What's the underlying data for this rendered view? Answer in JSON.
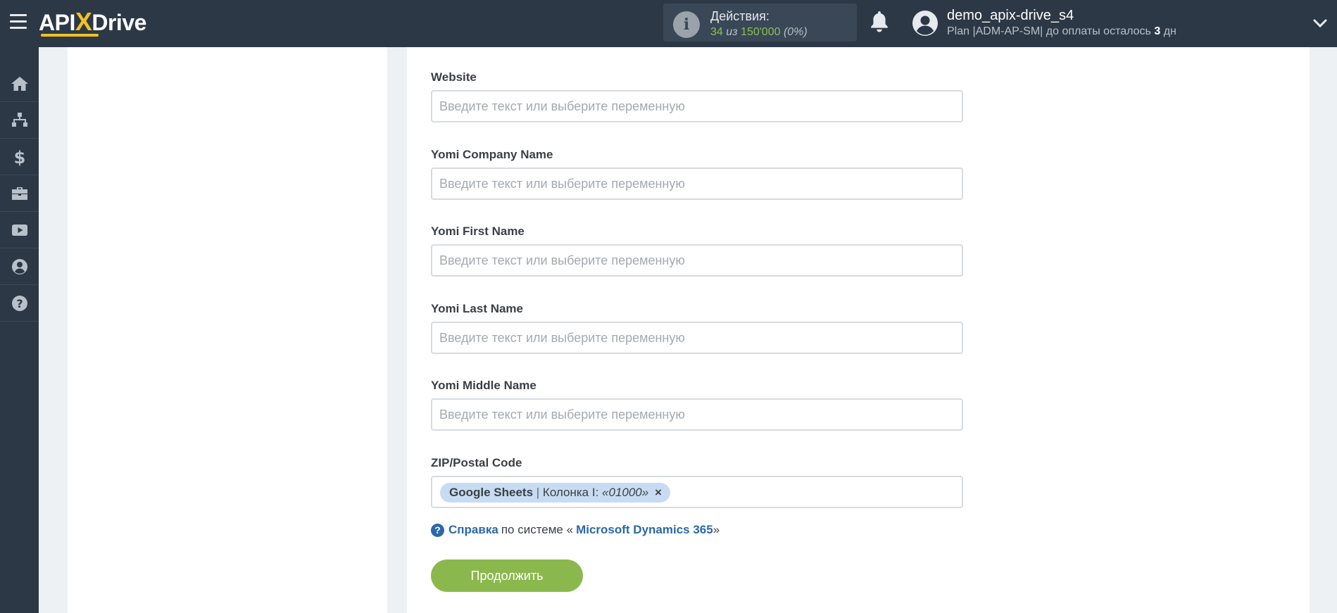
{
  "header": {
    "logo_prefix": "API",
    "logo_x": "X",
    "logo_suffix": "Drive",
    "actions_label": "Действия:",
    "actions_used": "34",
    "actions_of": "из",
    "actions_total": "150'000",
    "actions_percent": "(0%)",
    "user_name": "demo_apix-drive_s4",
    "plan_text": "Plan |ADM-AP-SM| до оплаты осталось",
    "plan_days": "3",
    "plan_days_unit": "дн",
    "accent_color": "#f4c022"
  },
  "sidebar": {
    "items": [
      {
        "icon": "home-icon"
      },
      {
        "icon": "sitemap-icon"
      },
      {
        "icon": "dollar-icon"
      },
      {
        "icon": "briefcase-icon"
      },
      {
        "icon": "youtube-icon"
      },
      {
        "icon": "user-circle-icon"
      },
      {
        "icon": "question-icon"
      }
    ]
  },
  "form": {
    "placeholder": "Введите текст или выберите переменную",
    "fields": [
      {
        "label": "Website",
        "value": ""
      },
      {
        "label": "Yomi Company Name",
        "value": ""
      },
      {
        "label": "Yomi First Name",
        "value": ""
      },
      {
        "label": "Yomi Last Name",
        "value": ""
      },
      {
        "label": "Yomi Middle Name",
        "value": ""
      }
    ],
    "zip_label": "ZIP/Postal Code",
    "zip_tag": {
      "source": "Google Sheets",
      "separator": "|",
      "column": "Колонка I:",
      "value": "«01000»",
      "remove": "×"
    },
    "help": {
      "link_text": "Справка",
      "middle_text": "по системе «",
      "system_name": "Microsoft Dynamics 365",
      "end_text": "»"
    },
    "continue_label": "Продолжить"
  }
}
